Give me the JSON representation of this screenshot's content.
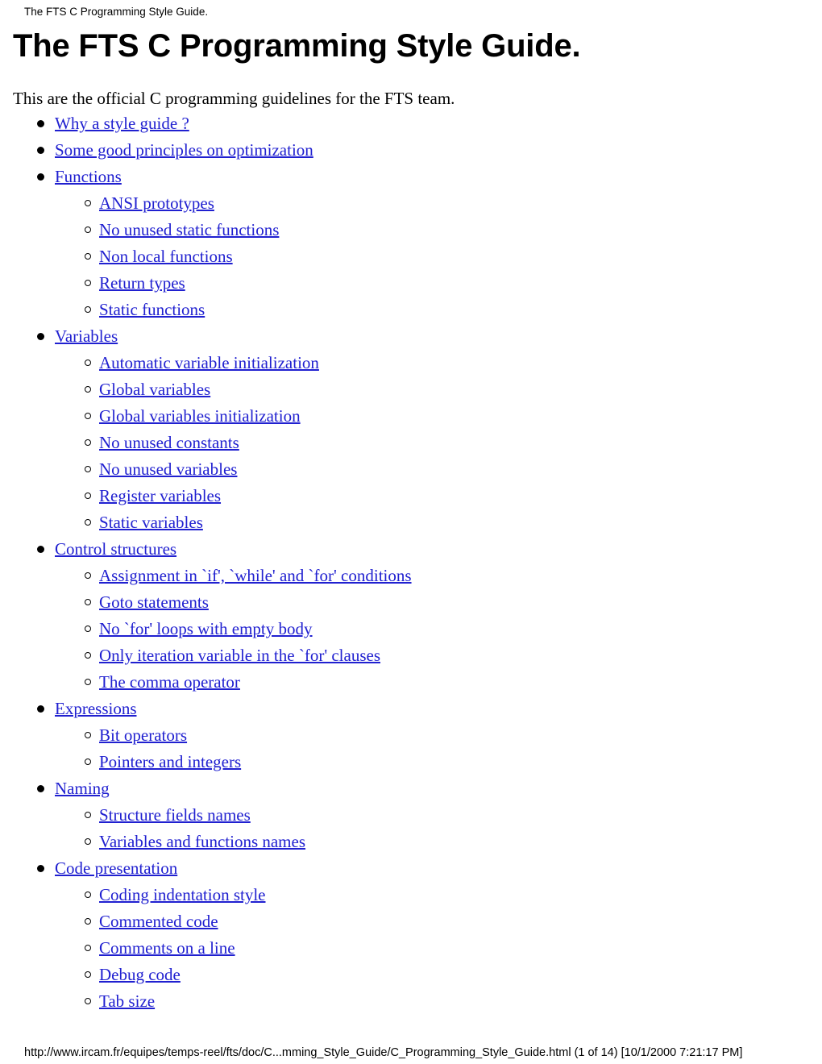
{
  "header": {
    "running_head": "The FTS C Programming Style Guide.",
    "title": "The FTS C Programming Style Guide."
  },
  "intro": {
    "paragraph": "This are the official C programming guidelines for the FTS team."
  },
  "colors": {
    "link": "#2020d0",
    "text": "#000000",
    "background": "#ffffff"
  },
  "toc": {
    "items": [
      {
        "label": "Why a style guide ?",
        "children": []
      },
      {
        "label": "Some good principles on optimization",
        "children": []
      },
      {
        "label": "Functions",
        "children": [
          {
            "label": "ANSI prototypes"
          },
          {
            "label": "No unused static functions"
          },
          {
            "label": "Non local functions"
          },
          {
            "label": "Return types"
          },
          {
            "label": "Static functions"
          }
        ]
      },
      {
        "label": "Variables",
        "children": [
          {
            "label": "Automatic variable initialization"
          },
          {
            "label": "Global variables"
          },
          {
            "label": "Global variables initialization"
          },
          {
            "label": "No unused constants"
          },
          {
            "label": "No unused variables"
          },
          {
            "label": "Register variables"
          },
          {
            "label": "Static variables"
          }
        ]
      },
      {
        "label": "Control structures",
        "children": [
          {
            "label": "Assignment in `if', `while' and `for' conditions"
          },
          {
            "label": "Goto statements"
          },
          {
            "label": "No `for' loops with empty body"
          },
          {
            "label": "Only iteration variable in the `for' clauses"
          },
          {
            "label": "The comma operator"
          }
        ]
      },
      {
        "label": "Expressions",
        "children": [
          {
            "label": "Bit operators"
          },
          {
            "label": "Pointers and integers"
          }
        ]
      },
      {
        "label": "Naming",
        "children": [
          {
            "label": "Structure fields names"
          },
          {
            "label": "Variables and functions names"
          }
        ]
      },
      {
        "label": "Code presentation",
        "children": [
          {
            "label": "Coding indentation style"
          },
          {
            "label": "Commented code"
          },
          {
            "label": "Comments on a line"
          },
          {
            "label": "Debug code"
          },
          {
            "label": "Tab size"
          }
        ]
      }
    ]
  },
  "footer": {
    "text": "http://www.ircam.fr/equipes/temps-reel/fts/doc/C...mming_Style_Guide/C_Programming_Style_Guide.html (1 of 14) [10/1/2000 7:21:17 PM]"
  }
}
